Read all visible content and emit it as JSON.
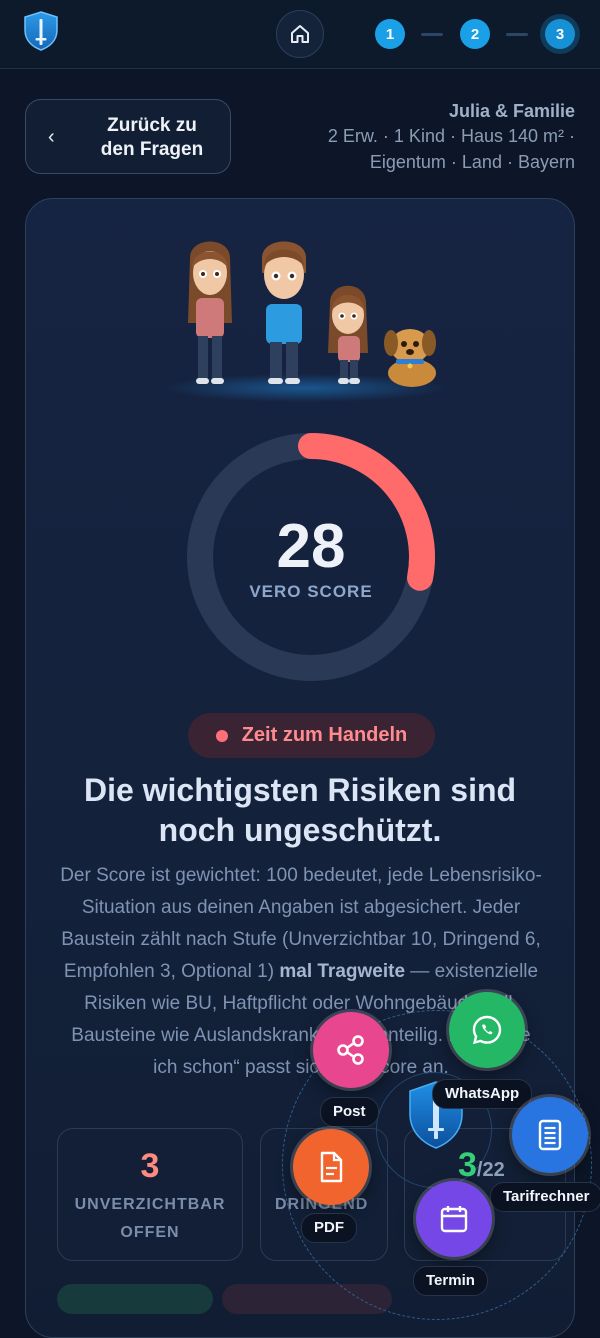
{
  "header": {
    "steps": [
      "1",
      "2",
      "3"
    ]
  },
  "back_button": {
    "label_line1": "Zurück zu",
    "label_line2": "den Fragen"
  },
  "profile": {
    "name": "Julia & Familie",
    "line1": "2 Erw. · 1 Kind · Haus 140 m² ·",
    "line2": "Eigentum · Land · Bayern"
  },
  "score": {
    "value": "28",
    "fraction": 0.28,
    "label": "VERO SCORE",
    "color": "#ff6b6b"
  },
  "status": {
    "text": "Zeit zum Handeln"
  },
  "headline": {
    "line1": "Die wichtigsten Risiken sind",
    "line2": "noch ungeschützt."
  },
  "description": {
    "part1": "Der Score ist gewichtet: 100 bedeutet, jede Lebensrisiko-Situation aus deinen Angaben ist abgesichert. Jeder Baustein zählt nach Stufe (Unverzichtbar 10, Dringend 6, Empfohlen 3, Optional 1) ",
    "bold": "mal Tragweite",
    "part2": " — existenzielle Risiken wie BU, Haftpflicht oder Wohngebäude voll, Bausteine wie Auslandskranken nur anteilig. Mit „Habe ich schon“ passt sich der Score an."
  },
  "stats": [
    {
      "number": "3",
      "label_line1": "UNVERZICHTBAR",
      "label_line2": "OFFEN",
      "color": "#ff8a80"
    },
    {
      "number": "",
      "label_line1": "DRINGEND",
      "label_line2": "",
      "color": "#f3b64c"
    },
    {
      "number": "3",
      "denominator": "/22",
      "label_line1": "",
      "label_line2": "",
      "color": "#35d07a"
    }
  ],
  "fab_menu": {
    "post": "Post",
    "whatsapp": "WhatsApp",
    "tarifrechner": "Tarifrechner",
    "pdf": "PDF",
    "termin": "Termin"
  },
  "icons": {
    "logo": "shield-sword-icon",
    "home": "home-icon",
    "back": "chevron-left-icon",
    "post": "share-icon",
    "whatsapp": "whatsapp-icon",
    "tarifrechner": "calculator-icon",
    "pdf": "document-icon",
    "termin": "calendar-icon"
  }
}
